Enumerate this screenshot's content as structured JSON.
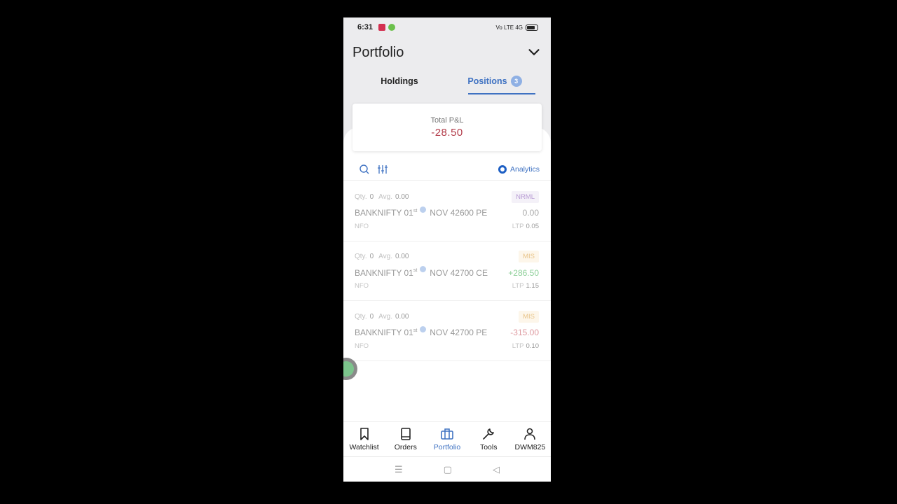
{
  "status_bar": {
    "time": "6:31",
    "signal_text": "Vo LTE 4G"
  },
  "header": {
    "title": "Portfolio",
    "collapse_icon": "chevron-down-icon"
  },
  "tabs": [
    {
      "label": "Holdings",
      "active": false
    },
    {
      "label": "Positions",
      "active": true,
      "badge": "3"
    }
  ],
  "summary": {
    "label": "Total P&L",
    "value": "-28.50",
    "value_color": "#b23a48"
  },
  "toolbar": {
    "search_icon": "search-icon",
    "filter_icon": "sliders-icon",
    "analytics_label": "Analytics"
  },
  "positions": [
    {
      "qty_label": "Qty.",
      "qty": "0",
      "avg_label": "Avg.",
      "avg": "0.00",
      "product": "NRML",
      "symbol": "BANKNIFTY 01",
      "suffix": "st",
      "expiry": "NOV 42600 PE",
      "pnl": "0.00",
      "exchange": "NFO",
      "ltp_label": "LTP",
      "ltp": "0.05"
    },
    {
      "qty_label": "Qty.",
      "qty": "0",
      "avg_label": "Avg.",
      "avg": "0.00",
      "product": "MIS",
      "symbol": "BANKNIFTY 01",
      "suffix": "st",
      "expiry": "NOV 42700 CE",
      "pnl": "+286.50",
      "exchange": "NFO",
      "ltp_label": "LTP",
      "ltp": "1.15"
    },
    {
      "qty_label": "Qty.",
      "qty": "0",
      "avg_label": "Avg.",
      "avg": "0.00",
      "product": "MIS",
      "symbol": "BANKNIFTY 01",
      "suffix": "st",
      "expiry": "NOV 42700 PE",
      "pnl": "-315.00",
      "exchange": "NFO",
      "ltp_label": "LTP",
      "ltp": "0.10"
    }
  ],
  "bottom_nav": [
    {
      "label": "Watchlist",
      "icon": "bookmark-icon"
    },
    {
      "label": "Orders",
      "icon": "book-icon"
    },
    {
      "label": "Portfolio",
      "icon": "briefcase-icon",
      "active": true
    },
    {
      "label": "Tools",
      "icon": "wrench-icon"
    },
    {
      "label": "DWM825",
      "icon": "user-icon"
    }
  ],
  "system_nav": {
    "menu": "☰",
    "home": "▢",
    "back": "◁"
  },
  "colors": {
    "accent": "#3f72c2",
    "loss": "#b23a48",
    "profit": "#8fd09a"
  }
}
